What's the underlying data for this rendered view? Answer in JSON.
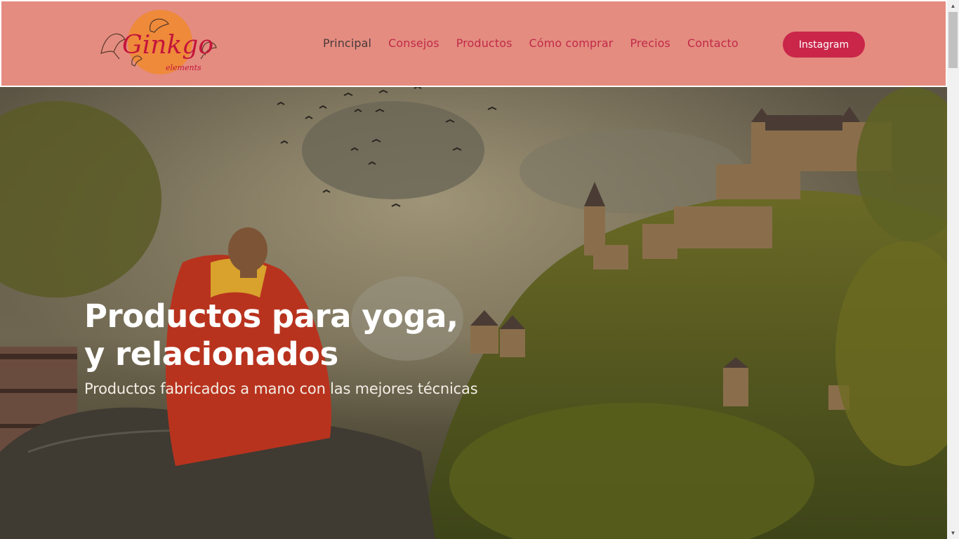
{
  "header": {
    "logo_text": "Ginkgo",
    "logo_subtext": "elements",
    "nav": [
      {
        "label": "Principal",
        "active": true
      },
      {
        "label": "Consejos",
        "active": false
      },
      {
        "label": "Productos",
        "active": false
      },
      {
        "label": "Cómo comprar",
        "active": false
      },
      {
        "label": "Precios",
        "active": false
      },
      {
        "label": "Contacto",
        "active": false
      }
    ],
    "cta_label": "Instagram"
  },
  "hero": {
    "title_line1": "Productos para yoga,",
    "title_line2": "y relacionados",
    "subtitle": "Productos fabricados a mano con las mejores técnicas"
  },
  "colors": {
    "header_bg": "#e48c80",
    "nav_link": "#c02a48",
    "nav_active": "#4a3a3a",
    "button_bg": "#c9264a"
  },
  "icons": {
    "scroll_up": "scroll-up-arrow-icon",
    "scroll_down": "scroll-down-arrow-icon"
  }
}
